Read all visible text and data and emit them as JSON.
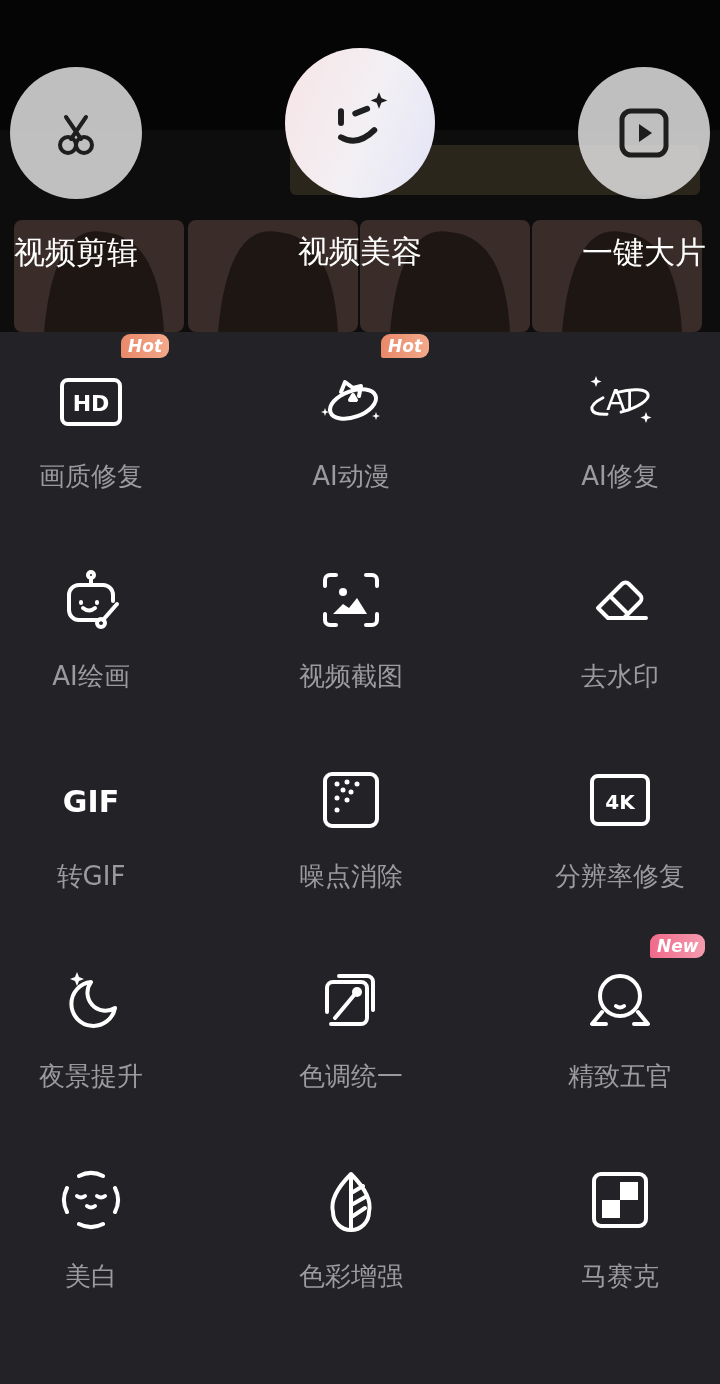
{
  "top_actions": [
    {
      "label": "视频剪辑",
      "kind": "scissors",
      "featured": false
    },
    {
      "label": "视频美容",
      "kind": "smile",
      "featured": true
    },
    {
      "label": "一键大片",
      "kind": "play",
      "featured": false
    }
  ],
  "tools": [
    {
      "label": "画质修复",
      "kind": "hd",
      "icon_text": "HD",
      "badge": {
        "text": "Hot",
        "kind": "hot"
      }
    },
    {
      "label": "AI动漫",
      "kind": "anime",
      "badge": {
        "text": "Hot",
        "kind": "hot"
      }
    },
    {
      "label": "AI修复",
      "kind": "ai",
      "icon_text": "AI"
    },
    {
      "label": "AI绘画",
      "kind": "robot"
    },
    {
      "label": "视频截图",
      "kind": "screenshot"
    },
    {
      "label": "去水印",
      "kind": "eraser"
    },
    {
      "label": "转GIF",
      "kind": "gif",
      "icon_text": "GIF"
    },
    {
      "label": "噪点消除",
      "kind": "noise"
    },
    {
      "label": "分辨率修复",
      "kind": "resolution",
      "icon_text": "4K"
    },
    {
      "label": "夜景提升",
      "kind": "moon"
    },
    {
      "label": "色调统一",
      "kind": "picker"
    },
    {
      "label": "精致五官",
      "kind": "face",
      "badge": {
        "text": "New",
        "kind": "new"
      }
    },
    {
      "label": "美白",
      "kind": "beauty"
    },
    {
      "label": "色彩增强",
      "kind": "leaf"
    },
    {
      "label": "马赛克",
      "kind": "mosaic"
    }
  ]
}
